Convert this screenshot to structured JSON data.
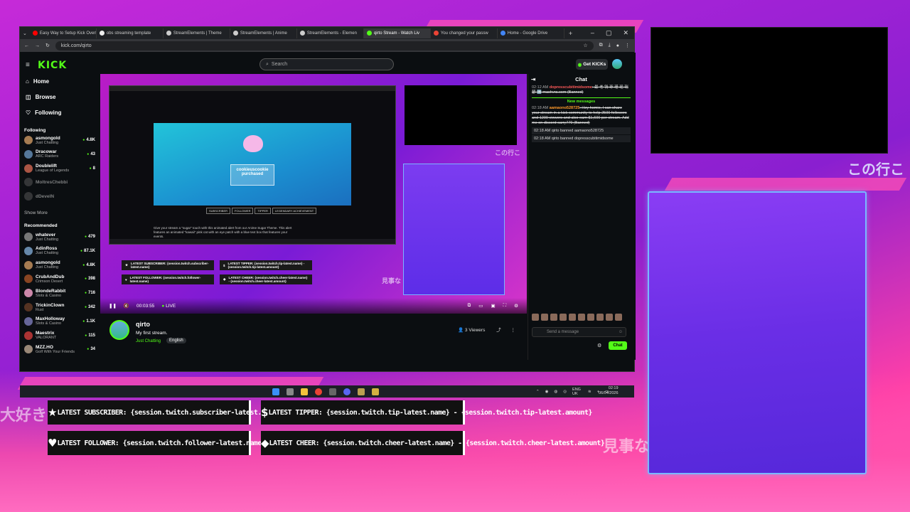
{
  "browser": {
    "tabs": [
      {
        "title": "Easy Way to Setup Kick Overlay",
        "color": "#ff0000"
      },
      {
        "title": "obs streaming template",
        "color": "#eeeeee"
      },
      {
        "title": "StreamElements | Theme",
        "color": "#cccccc"
      },
      {
        "title": "StreamElements | Anime",
        "color": "#cccccc"
      },
      {
        "title": "StreamElements - Elemen",
        "color": "#cccccc"
      },
      {
        "title": "qirto Stream - Watch Liv",
        "color": "#53fc18"
      },
      {
        "title": "You changed your passw",
        "color": "#ea4335"
      },
      {
        "title": "Home - Google Drive",
        "color": "#4285f4"
      }
    ],
    "url": "kick.com/qirto",
    "new_tab": "+",
    "win_buttons": [
      "–",
      "▢",
      "✕"
    ]
  },
  "kick": {
    "logo": "KICK",
    "search_placeholder": "Search",
    "get_kicks": "Get KICKs",
    "nav": [
      {
        "label": "Home",
        "icon": "home-icon"
      },
      {
        "label": "Browse",
        "icon": "browse-icon"
      },
      {
        "label": "Following",
        "icon": "heart-icon"
      }
    ],
    "following_title": "Following",
    "following": [
      {
        "name": "asmongold",
        "game": "Just Chatting",
        "viewers": "4.8K",
        "color": "#a67c52",
        "offline": false
      },
      {
        "name": "Dracowar",
        "game": "ARC Raiders",
        "viewers": "43",
        "color": "#557799",
        "offline": false
      },
      {
        "name": "Doublelift",
        "game": "League of Legends",
        "viewers": "8",
        "color": "#aa5544",
        "offline": false
      },
      {
        "name": "MoltresChebbi",
        "game": "",
        "viewers": "",
        "color": "#666666",
        "offline": true
      },
      {
        "name": "dDevelN",
        "game": "",
        "viewers": "",
        "color": "#666666",
        "offline": true
      }
    ],
    "show_more": "Show More",
    "recommended_title": "Recommended",
    "recommended": [
      {
        "name": "whatever",
        "game": "Just Chatting",
        "viewers": "479",
        "color": "#777777"
      },
      {
        "name": "AdinRoss",
        "game": "Just Chatting",
        "viewers": "87.1K",
        "color": "#6688aa"
      },
      {
        "name": "asmongold",
        "game": "Just Chatting",
        "viewers": "4.8K",
        "color": "#a67c52"
      },
      {
        "name": "CrubAndDub",
        "game": "Crimson Desert",
        "viewers": "398",
        "color": "#884422"
      },
      {
        "name": "BlondeRabbit",
        "game": "Slots & Casino",
        "viewers": "716",
        "color": "#cc88aa"
      },
      {
        "name": "TrickinClown",
        "game": "Rust",
        "viewers": "342",
        "color": "#553322"
      },
      {
        "name": "MaxHolloway",
        "game": "Slots & Casino",
        "viewers": "1.1K",
        "color": "#666699"
      },
      {
        "name": "Maestrix",
        "game": "VALORANT",
        "viewers": "115",
        "color": "#aa3333"
      },
      {
        "name": "MZZ.HO",
        "game": "Golf With Your Friends",
        "viewers": "34",
        "color": "#998877"
      }
    ],
    "player": {
      "time": "00:03:55",
      "live": "LIVE",
      "inner_hero_text": "cookieuscookie purchased",
      "inner_pills": [
        "SUBSCRIBER",
        "FOLLOWER",
        "TIPPER",
        "LEGENDARY ACHIEVEMENT"
      ],
      "inner_desc": "Give your stream a \"sugar\" touch with this animated alert from our Anime Sugar Theme. This alert features an animated \"kawaii\" pink cat with an eye patch with a blue text box that features your events.",
      "mini_alerts": [
        "LATEST SUBSCRIBER: {session.twitch.subscriber-latest.name}",
        "LATEST TIPPER: {session.twitch.tip-latest.name} - {session.twitch.tip-latest.amount}",
        "LATEST FOLLOWER: {session.twitch.follower-latest.name}",
        "LATEST CHEER: {session.twitch.cheer-latest.name} - {session.twitch.cheer-latest.amount}"
      ],
      "mini_jp": [
        "見事な",
        "この行こ"
      ]
    },
    "stream": {
      "name": "qirto",
      "title": "My first stream.",
      "category": "Just Chatting",
      "language": "English",
      "viewers": "3 Viewers"
    },
    "chat": {
      "title": "Chat",
      "messages": [
        {
          "time": "02:12 AM",
          "user": "dopresscubitimidsome",
          "text": ": 最 老 钱 琢 瑾 瑶 瑞 瑟 ➡️ machvra.com (Banned)"
        },
        {
          "time": "02:18 AM",
          "user": "aamaono528725",
          "text": ": Hey homie, I can share your stream in a kick community to help 2500 followers and 1200 viewers and also earn $1,600 per stream. Add me on discord carry779 (Banned)"
        }
      ],
      "new_messages": "New messages",
      "bans": [
        "02:18 AM  qirto banned aamaono528725",
        "02:18 AM  qirto banned dopresscubitimidsome"
      ],
      "input_placeholder": "Send a message",
      "send_label": "Chat"
    },
    "taskbar": {
      "lang": "ENG UK",
      "time": "02:19",
      "date": "06/04/2026"
    }
  },
  "overlay": {
    "jp_left": "大好き",
    "jp_right": "この行こ",
    "jp_bottom": "見事な",
    "alerts": [
      {
        "icon": "star-icon",
        "glyph": "★",
        "text": "LATEST SUBSCRIBER: {session.twitch.subscriber-latest.name}"
      },
      {
        "icon": "dollar-icon",
        "glyph": "$",
        "text": "LATEST TIPPER: {session.twitch.tip-latest.name} - {session.twitch.tip-latest.amount}"
      },
      {
        "icon": "heart-icon",
        "glyph": "♥",
        "text": "LATEST FOLLOWER: {session.twitch.follower-latest.name}"
      },
      {
        "icon": "diamond-icon",
        "glyph": "◆",
        "text": "LATEST CHEER: {session.twitch.cheer-latest.name} - {session.twitch.cheer-latest.amount}"
      }
    ]
  }
}
